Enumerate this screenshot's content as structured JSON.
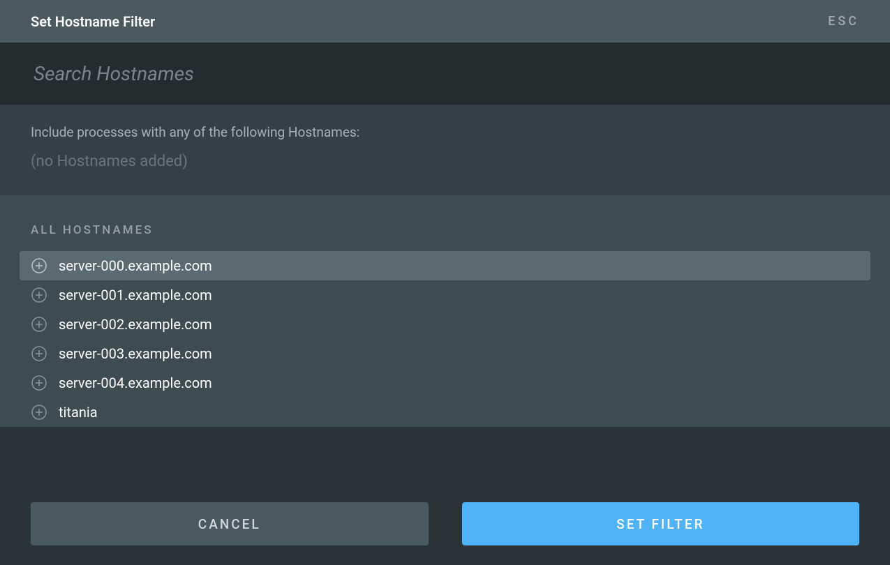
{
  "header": {
    "title": "Set Hostname Filter",
    "esc": "ESC"
  },
  "search": {
    "placeholder": "Search Hostnames",
    "value": ""
  },
  "include": {
    "label": "Include processes with any of the following Hostnames:",
    "empty": "(no Hostnames added)"
  },
  "hostnames": {
    "header": "ALL HOSTNAMES",
    "items": [
      {
        "name": "server-000.example.com",
        "highlighted": true
      },
      {
        "name": "server-001.example.com",
        "highlighted": false
      },
      {
        "name": "server-002.example.com",
        "highlighted": false
      },
      {
        "name": "server-003.example.com",
        "highlighted": false
      },
      {
        "name": "server-004.example.com",
        "highlighted": false
      },
      {
        "name": "titania",
        "highlighted": false
      }
    ]
  },
  "footer": {
    "cancel": "CANCEL",
    "submit": "SET FILTER"
  }
}
